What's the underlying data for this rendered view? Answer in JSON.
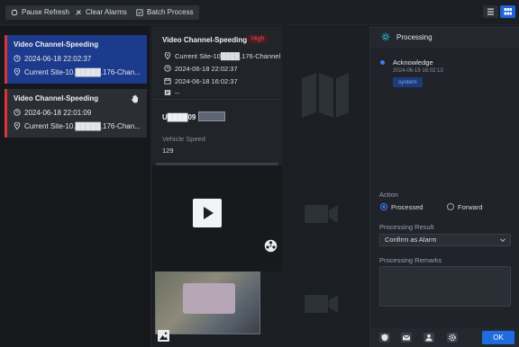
{
  "toolbar": {
    "pause_refresh": "Pause Refresh",
    "clear_alarms": "Clear Alarms",
    "batch_process": "Batch Process"
  },
  "alarms": [
    {
      "title": "Video Channel-Speeding",
      "time": "2024-06-18 22:02:37",
      "site": "Current Site-10.█████.176-Chan..."
    },
    {
      "title": "Video Channel-Speeding",
      "time": "2024-06-18 22:01:09",
      "site": "Current Site-10.█████.176-Chan..."
    }
  ],
  "detail": {
    "title": "Video Channel-Speeding",
    "level": "High",
    "site": "Current Site-10████.176-Channel 1",
    "start_time": "2024-06-18 22:02:37",
    "end_time": "2024-06-18 16:02:37",
    "note": "--",
    "plate": "U████09",
    "speed_label": "Vehicle Speed",
    "speed_value": "129"
  },
  "processing": {
    "header": "Processing",
    "ack_label": "Acknowledge",
    "ack_time": "2024-06-19 16:02:13",
    "ack_tag": "system",
    "action_label": "Action",
    "action_processed": "Processed",
    "action_forward": "Forward",
    "result_label": "Processing Result",
    "result_value": "Confirm as Alarm",
    "remarks_label": "Processing Remarks",
    "ok": "OK"
  },
  "colors": {
    "accent": "#1f6ce0",
    "selected_card": "#1d3b8c",
    "alarm_red": "#d8353b"
  }
}
